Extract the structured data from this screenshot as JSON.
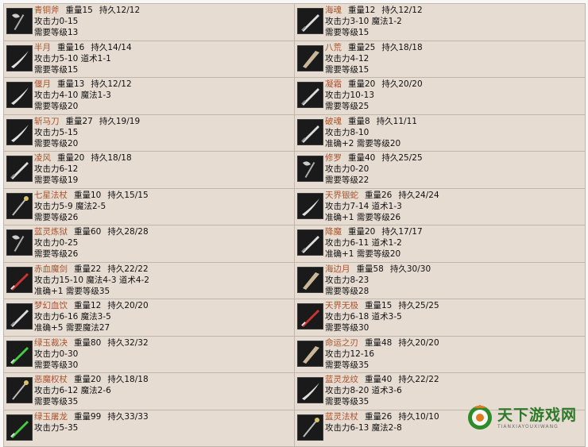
{
  "items": [
    {
      "name": "青铜斧",
      "weight": "重量15",
      "dur": "持久12/12",
      "stats": "攻击力0-15",
      "req": "需要等级13",
      "icon": "axe-icon"
    },
    {
      "name": "海魂",
      "weight": "重量12",
      "dur": "持久12/12",
      "stats": "攻击力3-10 魔法1-2",
      "req": "需要等级15",
      "icon": "sword-icon"
    },
    {
      "name": "半月",
      "weight": "重量16",
      "dur": "持久14/14",
      "stats": "攻击力5-10 道术1-1",
      "req": "需要等级15",
      "icon": "saber-icon"
    },
    {
      "name": "八荒",
      "weight": "重量25",
      "dur": "持久18/18",
      "stats": "攻击力4-12",
      "req": "需要等级15",
      "icon": "blade-icon"
    },
    {
      "name": "偃月",
      "weight": "重量13",
      "dur": "持久12/12",
      "stats": "攻击力4-10 魔法1-3",
      "req": "需要等级20",
      "icon": "saber-icon"
    },
    {
      "name": "凝霜",
      "weight": "重量20",
      "dur": "持久20/20",
      "stats": "攻击力10-13",
      "req": "需要等级25",
      "icon": "sword-icon"
    },
    {
      "name": "斩马刀",
      "weight": "重量27",
      "dur": "持久19/19",
      "stats": "攻击力5-15",
      "req": "需要等级20",
      "icon": "saber-icon"
    },
    {
      "name": "破魂",
      "weight": "重量8",
      "dur": "持久11/11",
      "stats": "攻击力8-10",
      "req": "准确+2 需要等级20",
      "icon": "sword-icon"
    },
    {
      "name": "凌风",
      "weight": "重量20",
      "dur": "持久18/18",
      "stats": "攻击力6-12",
      "req": "需要等级19",
      "icon": "sword-icon"
    },
    {
      "name": "修罗",
      "weight": "重量40",
      "dur": "持久25/25",
      "stats": "攻击力0-20",
      "req": "需要等级22",
      "icon": "axe-icon"
    },
    {
      "name": "七星法杖",
      "weight": "重量10",
      "dur": "持久15/15",
      "stats": "攻击力5-9 魔法2-5",
      "req": "需要等级26",
      "icon": "staff-icon"
    },
    {
      "name": "天界银蛇",
      "weight": "重量26",
      "dur": "持久24/24",
      "stats": "攻击力7-14 道术1-3",
      "req": "准确+1 需要等级26",
      "icon": "saber-icon"
    },
    {
      "name": "蓝灵炼狱",
      "weight": "重量60",
      "dur": "持久28/28",
      "stats": "攻击力0-25",
      "req": "需要等级26",
      "icon": "axe-icon"
    },
    {
      "name": "降魔",
      "weight": "重量20",
      "dur": "持久17/17",
      "stats": "攻击力6-11 道术1-2",
      "req": "准确+1 需要等级20",
      "icon": "sword-icon"
    },
    {
      "name": "赤血魔剑",
      "weight": "重量22",
      "dur": "持久22/22",
      "stats": "攻击力15-10 魔法4-3 道术4-2",
      "req": "准确+1 需要等级35",
      "icon": "red-sword-icon"
    },
    {
      "name": "海边月",
      "weight": "重量58",
      "dur": "持久30/30",
      "stats": "攻击力8-23",
      "req": "需要等级28",
      "icon": "blade-icon"
    },
    {
      "name": "梦幻血饮",
      "weight": "重量12",
      "dur": "持久20/20",
      "stats": "攻击力6-16 魔法3-5",
      "req": "准确+5 需要魔法27",
      "icon": "sword-icon"
    },
    {
      "name": "天界无极",
      "weight": "重量15",
      "dur": "持久25/25",
      "stats": "攻击力6-18 道术3-5",
      "req": "需要等级30",
      "icon": "red-sword-icon"
    },
    {
      "name": "绿玉裁决",
      "weight": "重量80",
      "dur": "持久32/32",
      "stats": "攻击力0-30",
      "req": "需要等级30",
      "icon": "green-sword-icon"
    },
    {
      "name": "命运之刃",
      "weight": "重量48",
      "dur": "持久20/20",
      "stats": "攻击力12-16",
      "req": "需要等级35",
      "icon": "blade-icon"
    },
    {
      "name": "恶魔权杖",
      "weight": "重量20",
      "dur": "持久18/18",
      "stats": "攻击力6-12 魔法2-6",
      "req": "需要等级35",
      "icon": "staff-icon"
    },
    {
      "name": "蓝灵龙纹",
      "weight": "重量40",
      "dur": "持久22/22",
      "stats": "攻击力8-20 道术3-6",
      "req": "需要等级35",
      "icon": "saber-icon"
    },
    {
      "name": "绿玉屠龙",
      "weight": "重量99",
      "dur": "持久33/33",
      "stats": "攻击力5-35",
      "req": "",
      "icon": "green-sword-icon"
    },
    {
      "name": "蓝灵法杖",
      "weight": "重量26",
      "dur": "持久10/10",
      "stats": "攻击力6-13 魔法2-8",
      "req": "",
      "icon": "staff-icon"
    }
  ],
  "watermark": {
    "title": "天下游戏网",
    "subtitle": "TIANXIAYOUXIWANG"
  },
  "colors": {
    "name": "#a8532b",
    "cell_bg": "#e6dcd2",
    "border": "#bfb6ac",
    "brand": "#2f7a2a"
  }
}
